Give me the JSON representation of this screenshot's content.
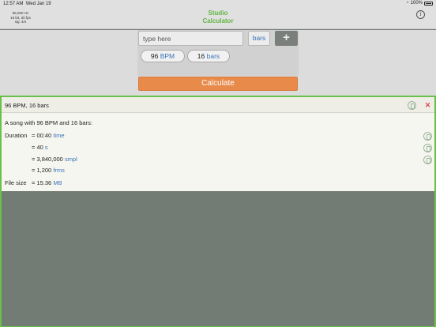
{
  "status": {
    "time": "12:57 AM",
    "date": "Wed Jan 19",
    "battery": "100%"
  },
  "audio_info": {
    "line1": "96,000 Hz",
    "line2": "16 bit, 30 fps",
    "line3": "sig: 4/4"
  },
  "app": {
    "title_line1": "Studio",
    "title_line2": "Calculator",
    "accent": "#63b644"
  },
  "input": {
    "placeholder": "type here",
    "unit_label": "bars",
    "add_label": "+"
  },
  "chips": [
    {
      "value": "96",
      "unit": "BPM"
    },
    {
      "value": "16",
      "unit": "bars"
    }
  ],
  "calculate_label": "Calculate",
  "result": {
    "title": "96 BPM, 16 bars",
    "summary": "A song with 96 BPM and 16 bars:",
    "duration_label": "Duration",
    "rows": [
      {
        "value": "= 00:40",
        "unit": "time"
      },
      {
        "value": "= 40",
        "unit": "s"
      },
      {
        "value": "= 3,840,000",
        "unit": "smpl"
      },
      {
        "value": "= 1,200",
        "unit": "frms"
      }
    ],
    "filesize_label": "File size",
    "filesize": {
      "value": "= 15.36",
      "unit": "MB"
    }
  },
  "colors": {
    "calculate": "#e88a4a",
    "unit_blue": "#3a73b8",
    "close_red": "#e0474c",
    "border_green": "#6bc04b"
  }
}
